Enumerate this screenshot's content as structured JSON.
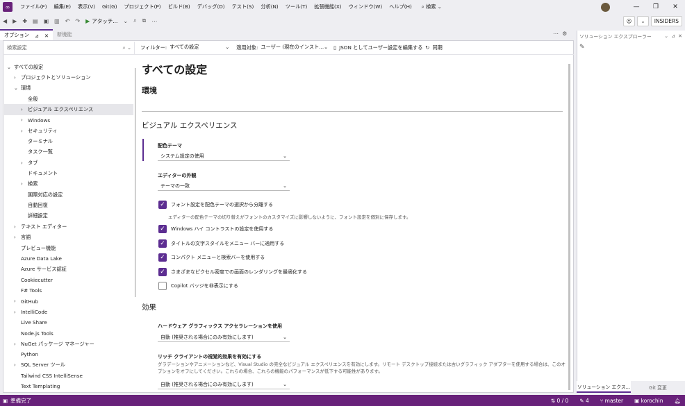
{
  "menu": [
    "ファイル(F)",
    "編集(E)",
    "表示(V)",
    "Git(G)",
    "プロジェクト(P)",
    "ビルド(B)",
    "デバッグ(D)",
    "テスト(S)",
    "分析(N)",
    "ツール(T)",
    "拡張機能(X)",
    "ウィンドウ(W)",
    "ヘルプ(H)"
  ],
  "search_label": "検索",
  "toolbar": {
    "run_label": "アタッチ...",
    "insiders": "INSIDERS"
  },
  "tabs": {
    "active": "オプション",
    "inactive": "新機能"
  },
  "filter": {
    "search_placeholder": "検索設定",
    "filter_label": "フィルター:",
    "filter_value": "すべての設定",
    "scope_label": "適用対象:",
    "scope_value": "ユーザー (現在のインスト...",
    "edit_json": "JSON としてユーザー設定を編集する",
    "sync": "同期"
  },
  "tree": [
    {
      "label": "すべての設定",
      "indent": 0,
      "chev": "⌄"
    },
    {
      "label": "プロジェクトとソリューション",
      "indent": 1,
      "chev": "›"
    },
    {
      "label": "環境",
      "indent": 1,
      "chev": "⌄"
    },
    {
      "label": "全般",
      "indent": 2,
      "chev": ""
    },
    {
      "label": "ビジュアル エクスペリエンス",
      "indent": 2,
      "chev": "›",
      "selected": true
    },
    {
      "label": "Windows",
      "indent": 2,
      "chev": "›"
    },
    {
      "label": "セキュリティ",
      "indent": 2,
      "chev": "›"
    },
    {
      "label": "ターミナル",
      "indent": 2,
      "chev": ""
    },
    {
      "label": "タスク一覧",
      "indent": 2,
      "chev": ""
    },
    {
      "label": "タブ",
      "indent": 2,
      "chev": "›"
    },
    {
      "label": "ドキュメント",
      "indent": 2,
      "chev": ""
    },
    {
      "label": "検索",
      "indent": 2,
      "chev": "›"
    },
    {
      "label": "国際対応の設定",
      "indent": 2,
      "chev": ""
    },
    {
      "label": "自動回復",
      "indent": 2,
      "chev": ""
    },
    {
      "label": "詳細設定",
      "indent": 2,
      "chev": ""
    },
    {
      "label": "テキスト エディター",
      "indent": 1,
      "chev": "›"
    },
    {
      "label": "言語",
      "indent": 1,
      "chev": "›"
    },
    {
      "label": "プレビュー機能",
      "indent": 1,
      "chev": ""
    },
    {
      "label": "Azure Data Lake",
      "indent": 1,
      "chev": ""
    },
    {
      "label": "Azure サービス認証",
      "indent": 1,
      "chev": ""
    },
    {
      "label": "Cookiecutter",
      "indent": 1,
      "chev": ""
    },
    {
      "label": "F# Tools",
      "indent": 1,
      "chev": ""
    },
    {
      "label": "GitHub",
      "indent": 1,
      "chev": "›"
    },
    {
      "label": "IntelliCode",
      "indent": 1,
      "chev": "›"
    },
    {
      "label": "Live Share",
      "indent": 1,
      "chev": ""
    },
    {
      "label": "Node.js Tools",
      "indent": 1,
      "chev": ""
    },
    {
      "label": "NuGet パッケージ マネージャー",
      "indent": 1,
      "chev": "›"
    },
    {
      "label": "Python",
      "indent": 1,
      "chev": ""
    },
    {
      "label": "SQL Server ツール",
      "indent": 1,
      "chev": "›"
    },
    {
      "label": "Tailwind CSS IntelliSense",
      "indent": 1,
      "chev": ""
    },
    {
      "label": "Text Templating",
      "indent": 1,
      "chev": ""
    }
  ],
  "content": {
    "title": "すべての設定",
    "env_heading": "環境",
    "visual_heading": "ビジュアル エクスペリエンス",
    "theme_label": "配色テーマ",
    "theme_value": "システム設定の使用",
    "editor_label": "エディターの外観",
    "editor_value": "テーマの一致",
    "checks": [
      {
        "label": "フォント設定を配色テーマの選択から分離する",
        "on": true
      },
      {
        "label": "Windows ハイ コントラストの設定を使用する",
        "on": true
      },
      {
        "label": "タイトルの文字スタイルをメニュー バーに適用する",
        "on": true
      },
      {
        "label": "コンパクト メニューと検索バーを使用する",
        "on": true
      },
      {
        "label": "さまざまなピクセル密度での画面のレンダリングを最適化する",
        "on": true
      },
      {
        "label": "Copilot バッジを非表示にする",
        "on": false
      }
    ],
    "font_desc": "エディターの配色テーマの切り替えがフォントのカスタマイズに影響しないように、フォント設定を個別に保存します。",
    "effects_heading": "効果",
    "hw_label": "ハードウェア グラフィックス アクセラレーションを使用",
    "hw_value": "自動 (推奨される場合にのみ有効にします)",
    "rich_label": "リッチ クライアントの視覚的効果を有効にする",
    "rich_desc": "グラデーションやアニメーションなど、Visual Studio の完全なビジュアル エクスペリエンスを有効にします。リモート デスクトップ接続または古いグラフィック アダプターを使用する場合は、このオプションをオフにしてください。これらの場合、これらの機能のパフォーマンスが低下する可能性があります。",
    "rich_value": "自動 (推奨される場合にのみ有効にします)"
  },
  "right_panel": {
    "title": "ソリューション エクスプローラー",
    "tab1": "ソリューション エクス...",
    "tab2": "Git 変更"
  },
  "status": {
    "ready": "準備完了",
    "updown": "0 / 0",
    "pencil": "4",
    "branch": "master",
    "repo": "korochin"
  },
  "colors": {
    "accent": "#5c2d91",
    "status_bar": "#68217a"
  }
}
